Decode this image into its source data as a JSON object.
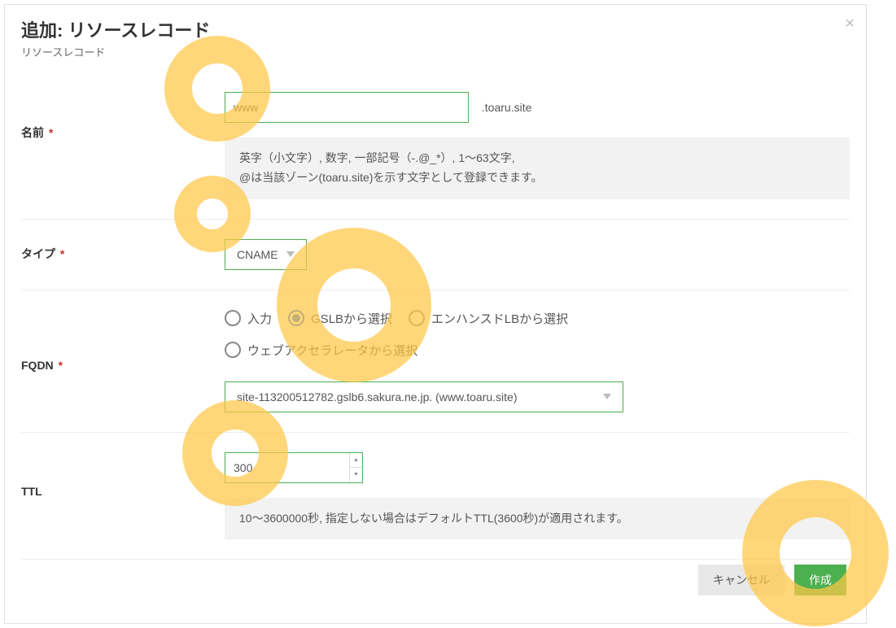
{
  "dialog": {
    "title": "追加: リソースレコード",
    "subtitle": "リソースレコード",
    "close_label": "×"
  },
  "name_row": {
    "label": "名前",
    "required": "*",
    "value": "www",
    "suffix": ".toaru.site",
    "hint_line1": "英字（小文字）, 数字, 一部記号（-.@_*）, 1〜63文字,",
    "hint_line2": "@は当該ゾーン(toaru.site)を示す文字として登録できます。"
  },
  "type_row": {
    "label": "タイプ",
    "required": "*",
    "value": "CNAME"
  },
  "fqdn_row": {
    "label": "FQDN",
    "required": "*",
    "options": [
      {
        "label": "入力",
        "selected": false
      },
      {
        "label": "GSLBから選択",
        "selected": true
      },
      {
        "label": "エンハンスドLBから選択",
        "selected": false
      },
      {
        "label": "ウェブアクセラレータから選択",
        "selected": false
      }
    ],
    "select_value": "site-113200512782.gslb6.sakura.ne.jp. (www.toaru.site)"
  },
  "ttl_row": {
    "label": "TTL",
    "value": "300",
    "hint": "10〜3600000秒, 指定しない場合はデフォルトTTL(3600秒)が適用されます。"
  },
  "footer": {
    "cancel": "キャンセル",
    "create": "作成"
  }
}
